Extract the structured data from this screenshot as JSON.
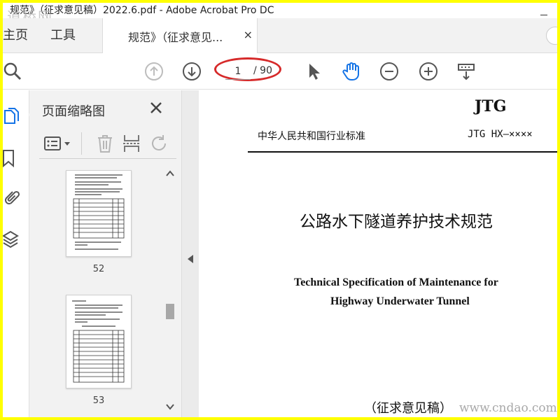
{
  "window": {
    "title": "规范》（征求意见稿）2022.6.pdf - Adobe Acrobat Pro DC",
    "watermark_logo": "道桥网"
  },
  "tabs": {
    "home_label": "主页",
    "tools_label": "工具",
    "doc_tab_label": "规范》（征求意见...",
    "doc_tab_close": "×"
  },
  "toolbar": {
    "current_page": "1",
    "total_pages": "/ 90",
    "icons": [
      "search-icon",
      "prev-page-icon",
      "next-page-icon",
      "select-cursor-icon",
      "hand-tool-icon",
      "zoom-out-icon",
      "zoom-in-icon",
      "scroll-mode-icon"
    ]
  },
  "thumbnail_panel": {
    "title": "页面缩略图",
    "close": "×",
    "thumbnails": [
      {
        "page_label": "52"
      },
      {
        "page_label": "53"
      }
    ]
  },
  "document": {
    "series_code": "JTG",
    "organization": "中华人民共和国行业标准",
    "standard_code": "JTG HX—××××",
    "title_cn": "公路水下隧道养护技术规范",
    "title_en_line1": "Technical Specification of Maintenance for",
    "title_en_line2": "Highway Underwater Tunnel",
    "draft_note": "（征求意见稿）",
    "watermark_url": "www.cndao.com"
  },
  "colors": {
    "highlight_border": "#ffff00",
    "annotation_red": "#d62a2a",
    "hand_tool_blue": "#1473e6",
    "icon_gray": "#555555"
  }
}
